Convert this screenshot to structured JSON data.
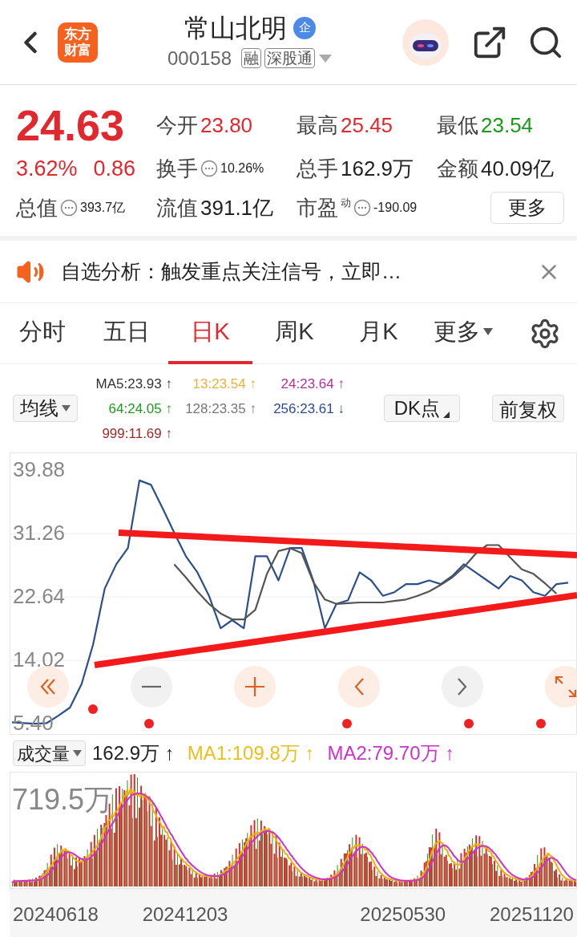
{
  "header": {
    "logo": "东方财富",
    "title": "常山北明",
    "title_badge": "企",
    "code": "000158",
    "tags": [
      "融",
      "深股通"
    ]
  },
  "quote": {
    "price": "24.63",
    "change_pct": "3.62%",
    "change": "0.86",
    "total_value": {
      "label": "总值",
      "value": "393.7亿"
    },
    "stats": [
      {
        "label": "今开",
        "value": "23.80",
        "kind": "up"
      },
      {
        "label": "最高",
        "value": "25.45",
        "kind": "up"
      },
      {
        "label": "最低",
        "value": "23.54",
        "kind": "down"
      },
      {
        "label": "换手",
        "value": "10.26%",
        "kind": "info"
      },
      {
        "label": "总手",
        "value": "162.9万",
        "kind": "plain"
      },
      {
        "label": "金额",
        "value": "40.09亿",
        "kind": "plain"
      },
      {
        "label": "流值",
        "value": "391.1亿",
        "kind": "plain"
      },
      {
        "label": "市盈",
        "sup": "动",
        "value": "-190.09",
        "kind": "info"
      }
    ],
    "more_button": "更多"
  },
  "notice": {
    "text": "自选分析：触发重点关注信号，立即…"
  },
  "tabs": [
    {
      "label": "分时",
      "selected": false
    },
    {
      "label": "五日",
      "selected": false
    },
    {
      "label": "日K",
      "selected": true
    },
    {
      "label": "周K",
      "selected": false
    },
    {
      "label": "月K",
      "selected": false
    },
    {
      "label": "更多",
      "selected": false,
      "kind": "dropdown"
    }
  ],
  "ma_legend": {
    "selector": "均线",
    "items": [
      {
        "text": "MA5:23.93",
        "arrow": "↑",
        "color": "#333333"
      },
      {
        "text": "13:23.54",
        "arrow": "↑",
        "color": "#e8b33a"
      },
      {
        "text": "24:23.64",
        "arrow": "↑",
        "color": "#b5309a"
      },
      {
        "text": "64:24.05",
        "arrow": "↑",
        "color": "#1e9a1e"
      },
      {
        "text": "128:23.35",
        "arrow": "↑",
        "color": "#777777"
      },
      {
        "text": "256:23.61",
        "arrow": "↓",
        "color": "#2d4a9a"
      },
      {
        "text": "999:11.69",
        "arrow": "↑",
        "color": "#a02a2a"
      }
    ],
    "dk_button": "DK点",
    "adjust_button": "前复权"
  },
  "price_chart": {
    "chart_data": {
      "type": "line",
      "ylim": [
        4.0,
        42.2
      ],
      "yticks": [
        {
          "value": 39.88,
          "label": "39.88"
        },
        {
          "value": 31.26,
          "label": "31.26"
        },
        {
          "value": 22.64,
          "label": "22.64"
        },
        {
          "value": 14.02,
          "label": "14.02"
        },
        {
          "value": 5.4,
          "label": "5.40"
        }
      ],
      "grid": true,
      "series": [
        {
          "color": "#2a4f8a",
          "values": [
            5.6,
            5.5,
            5.4,
            5.5,
            6.5,
            7.6,
            10.8,
            16.2,
            23.8,
            27.1,
            29.3,
            38.5,
            37.9,
            34.7,
            31.4,
            28.2,
            26.0,
            22.8,
            18.4,
            19.5,
            18.4,
            28.2,
            28.2,
            24.9,
            29.3,
            29.3,
            24.9,
            18.4,
            21.7,
            22.2,
            26.0,
            24.9,
            22.8,
            23.3,
            24.4,
            24.4,
            24.9,
            24.4,
            25.5,
            27.1,
            26.0,
            24.9,
            23.8,
            25.5,
            24.9,
            23.3,
            22.8,
            24.4,
            24.6
          ]
        },
        {
          "color": "#555555",
          "values": [
            null,
            null,
            null,
            null,
            null,
            null,
            null,
            null,
            null,
            null,
            null,
            null,
            null,
            null,
            27.1,
            25.3,
            23.4,
            21.7,
            20.4,
            19.6,
            19.6,
            20.9,
            25.8,
            28.9,
            29.3,
            28.6,
            24.7,
            22.3,
            21.7,
            21.8,
            21.9,
            21.9,
            21.9,
            22.1,
            22.3,
            22.8,
            23.4,
            24.3,
            25.3,
            26.7,
            28.5,
            29.7,
            29.7,
            28.0,
            26.4,
            25.8,
            24.5,
            23.1,
            null
          ]
        }
      ]
    }
  },
  "volume": {
    "selector": "成交量",
    "value": "162.9万",
    "value_arrow": "↑",
    "ma": [
      {
        "text": "MA1:109.8万 ↑",
        "color": "#e8c020"
      },
      {
        "text": "MA2:79.70万 ↑",
        "color": "#cc33cc"
      }
    ],
    "max_label": "719.5万",
    "dates": [
      "20240618",
      "20241203",
      "20250530",
      "20251120"
    ]
  }
}
